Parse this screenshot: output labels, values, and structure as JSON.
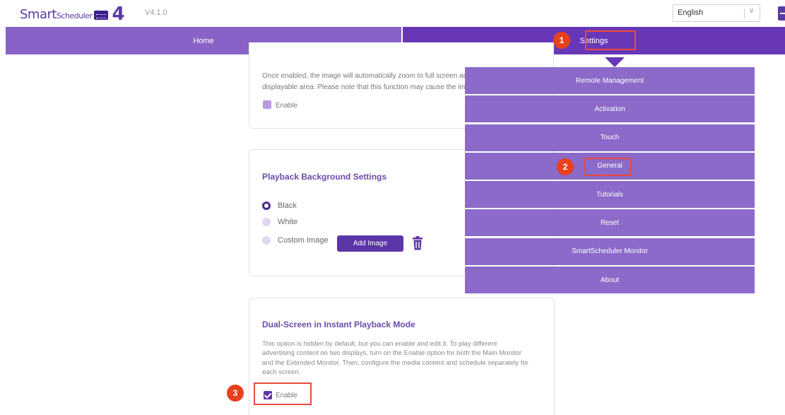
{
  "app": {
    "logo_text": "Smart",
    "logo_text_small": "Scheduler",
    "logo_number": "4",
    "version": "V4.1.0"
  },
  "language": {
    "selected": "English"
  },
  "nav": {
    "home": "Home",
    "settings": "Settings"
  },
  "settings_menu": {
    "items": [
      "Remote Management",
      "Activation",
      "Touch",
      "General",
      "Tutorials",
      "Reset",
      "SmartScheduler Monitor",
      "About"
    ]
  },
  "zoom_card": {
    "desc_line1": "Once enabled, the image will automatically zoom to full screen ac",
    "desc_line2": "displayable area. Please note that this function may cause the ima",
    "enable_label": "Enable",
    "enabled": false
  },
  "background_card": {
    "title": "Playback Background Settings",
    "options": [
      "Black",
      "White",
      "Custom Image"
    ],
    "selected": "Black",
    "add_image_label": "Add Image"
  },
  "dual_screen_card": {
    "title": "Dual-Screen in Instant Playback Mode",
    "desc_line1": "This option is hidden by default, but you can enable and edit it. To play different",
    "desc_line2": "advertising content on two displays, turn on the Enable option for both the Main Monitor",
    "desc_line3": "and the Extended Monitor. Then, configure the media content and schedule separately for",
    "desc_line4": "each screen.",
    "enable_label": "Enable",
    "enabled": true
  },
  "callouts": [
    "1",
    "2",
    "3"
  ],
  "colors": {
    "primary": "#6737b8",
    "home_tab": "#8862c6",
    "menu_item": "#8b6ac9",
    "highlight": "#e94b3c",
    "badge": "#e7411e"
  }
}
